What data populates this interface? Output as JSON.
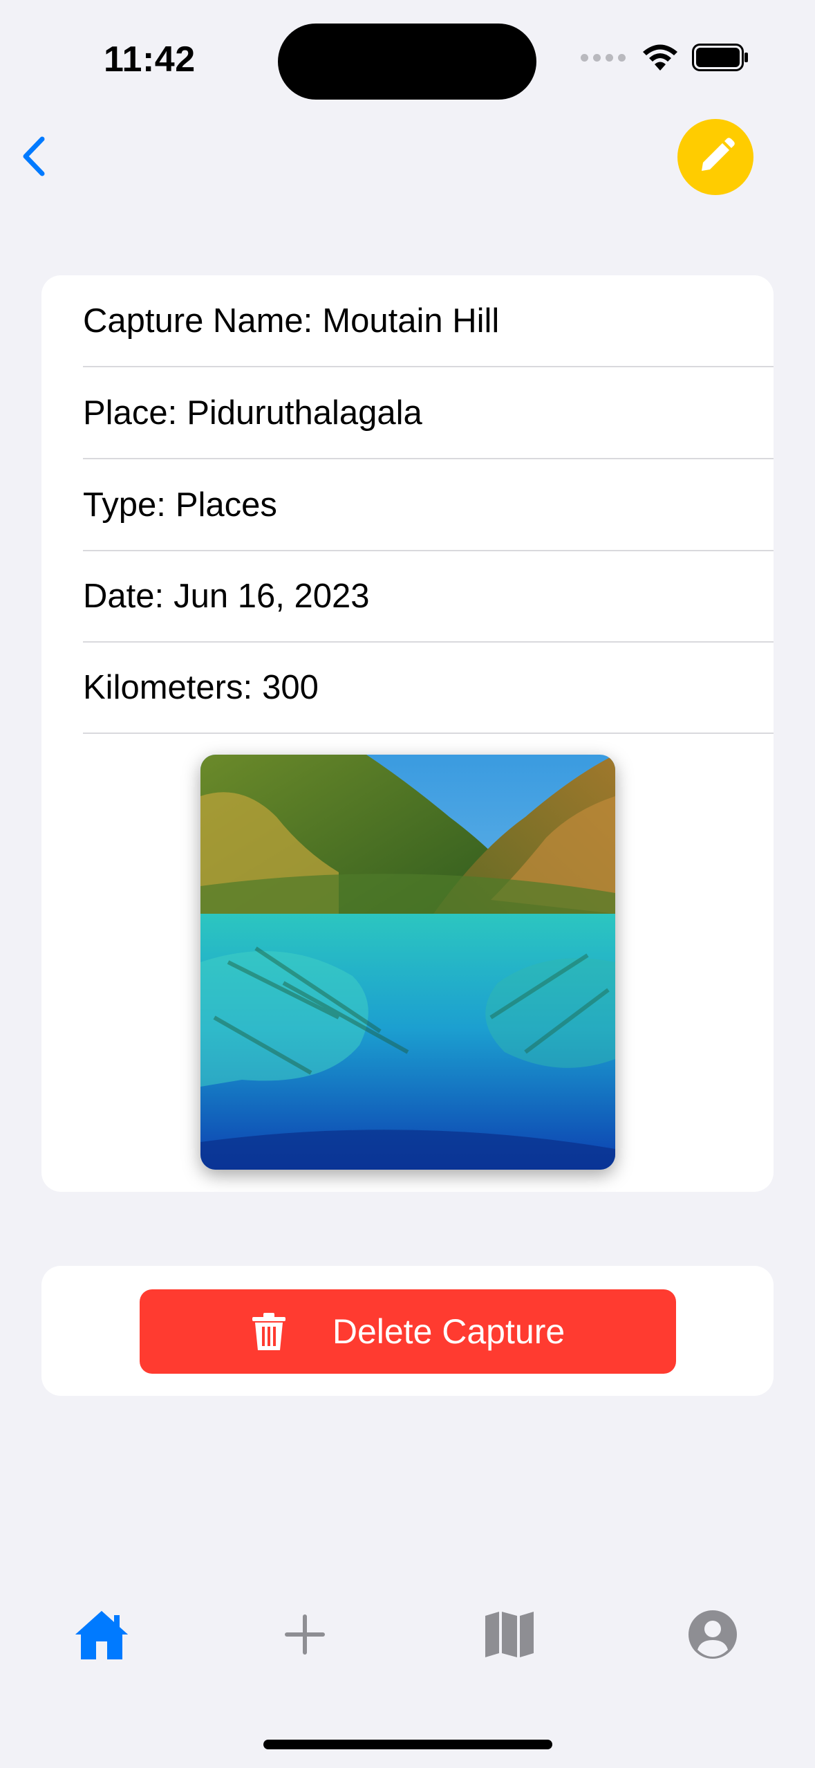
{
  "status_bar": {
    "time": "11:42"
  },
  "nav": {
    "back_icon": "chevron-left-icon",
    "edit_icon": "pencil-icon",
    "accent_color": "#007aff",
    "edit_color": "#ffcc00"
  },
  "details": {
    "rows": [
      {
        "label": "Capture Name:",
        "value": "Moutain Hill"
      },
      {
        "label": "Place:",
        "value": "Piduruthalagala"
      },
      {
        "label": "Type:",
        "value": "Places"
      },
      {
        "label": "Date:",
        "value": "Jun 16, 2023"
      },
      {
        "label": "Kilometers:",
        "value": "300"
      }
    ],
    "photo_subject": "turquoise lake with forested hills"
  },
  "actions": {
    "delete_label": "Delete Capture",
    "delete_icon": "trash-icon",
    "delete_color": "#ff3b30"
  },
  "tab_bar": {
    "items": [
      {
        "icon": "home-icon",
        "active": true
      },
      {
        "icon": "plus-icon",
        "active": false
      },
      {
        "icon": "map-icon",
        "active": false
      },
      {
        "icon": "profile-icon",
        "active": false
      }
    ]
  }
}
